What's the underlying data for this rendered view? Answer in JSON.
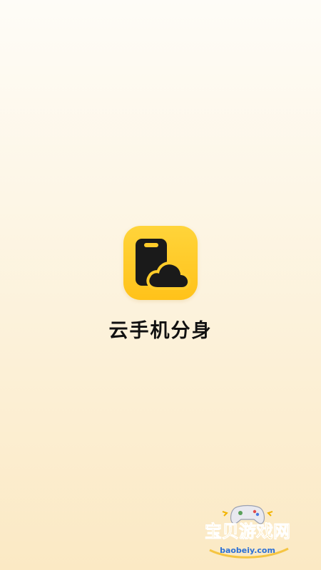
{
  "splash": {
    "app_name": "云手机分身",
    "app_icon": "phone-cloud-icon",
    "accent_color": "#ffc21a",
    "background_color": "#fdf6e6"
  },
  "watermark": {
    "icon": "gamepad-icon",
    "brand": "宝贝游戏网",
    "url": "baobeiy.com"
  }
}
